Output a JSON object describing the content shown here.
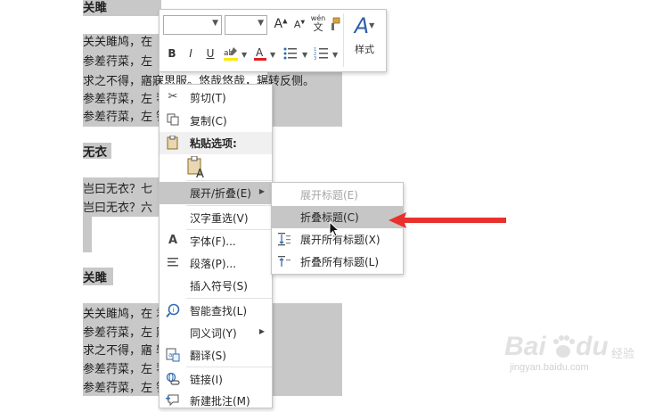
{
  "document": {
    "sections": [
      {
        "heading": "关雎",
        "lines": [
          "关关雎鸠，在",
          "参差荇菜，左",
          "求之不得，寤寐思服。悠哉悠哉，辗转反侧。",
          "参差荇菜，左                          琴瑟友之。",
          "参差荇菜，左                          钟鼓乐之。"
        ]
      },
      {
        "heading": "无衣",
        "lines": [
          "岂曰无衣？七",
          "岂曰无衣？六"
        ]
      },
      {
        "heading": "关雎",
        "lines": [
          "关关雎鸠，在                          君子好逑。",
          "参差荇菜，左                          寤寐求之。",
          "求之不得，寤                          辗转反侧。",
          "参差荇菜，左                          琴瑟友之。",
          "参差荇菜，左                          钟鼓乐之。"
        ]
      }
    ]
  },
  "mini_toolbar": {
    "font_name": "",
    "font_size": "",
    "grow_font": "A",
    "shrink_font": "A",
    "phonetic_top": "wén",
    "phonetic_bottom": "文",
    "bold": "B",
    "italic": "I",
    "underline": "U",
    "styles_glyph": "A",
    "styles_label": "样式",
    "highlight_color": "#ffe600",
    "font_color": "#e02020"
  },
  "context_menu": {
    "items": [
      {
        "label": "剪切(T)",
        "icon": "scissors-icon"
      },
      {
        "label": "复制(C)",
        "icon": "copy-icon"
      },
      {
        "label": "粘贴选项:",
        "icon": "clipboard-icon"
      },
      {
        "label": "展开/折叠(E)",
        "icon": "",
        "submenu": true
      },
      {
        "label": "汉字重选(V)",
        "icon": ""
      },
      {
        "label": "字体(F)...",
        "icon": "font-icon"
      },
      {
        "label": "段落(P)...",
        "icon": "paragraph-icon"
      },
      {
        "label": "插入符号(S)",
        "icon": ""
      },
      {
        "label": "智能查找(L)",
        "icon": "smart-lookup-icon"
      },
      {
        "label": "同义词(Y)",
        "icon": "",
        "submenu": true
      },
      {
        "label": "翻译(S)",
        "icon": "translate-icon"
      },
      {
        "label": "链接(I)",
        "icon": "link-icon"
      },
      {
        "label": "新建批注(M)",
        "icon": "comment-icon"
      }
    ]
  },
  "submenu": {
    "items": [
      {
        "label": "展开标题(E)",
        "disabled": true
      },
      {
        "label": "折叠标题(C)",
        "highlighted": true
      },
      {
        "label": "展开所有标题(X)"
      },
      {
        "label": "折叠所有标题(L)"
      }
    ]
  },
  "watermark": {
    "brand_left": "Bai",
    "brand_right": "百度",
    "brand_mid": "du",
    "url": "jingyan.baidu.com",
    "sub": "经验"
  },
  "colors": {
    "arrow": "#e8302e",
    "selection": "#c8c8c8",
    "menu_highlight": "#c6c6c6"
  }
}
